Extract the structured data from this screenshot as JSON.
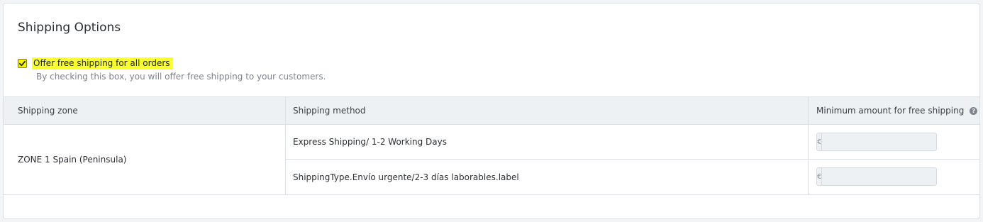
{
  "section": {
    "title": "Shipping Options"
  },
  "free_shipping": {
    "checked": true,
    "label": "Offer free shipping for all orders",
    "description": "By checking this box, you will offer free shipping to your customers."
  },
  "table": {
    "headers": {
      "zone": "Shipping zone",
      "method": "Shipping method",
      "minimum": "Minimum amount for free shipping"
    },
    "zone_name": "ZONE 1 Spain (Peninsula)",
    "rows": [
      {
        "method": "Express Shipping/ 1-2 Working Days",
        "currency": "€",
        "amount": ""
      },
      {
        "method": "ShippingType.Envío urgente/2-3 días laborables.label",
        "currency": "€",
        "amount": ""
      }
    ]
  }
}
